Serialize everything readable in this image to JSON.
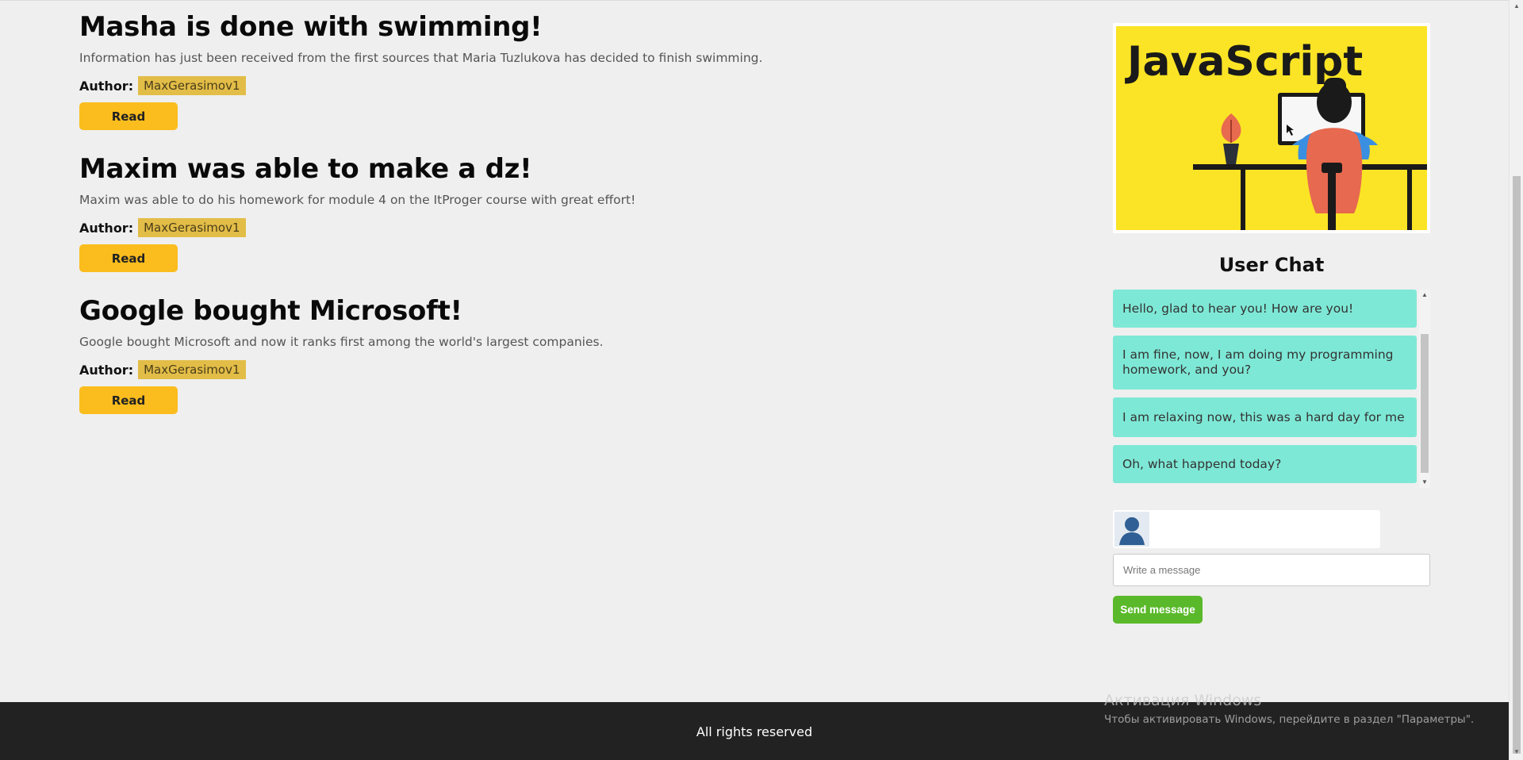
{
  "articles": [
    {
      "title": "Masha is done with swimming!",
      "description": "Information has just been received from the first sources that Maria Tuzlukova has decided to finish swimming.",
      "author_label": "Author:",
      "author": "MaxGerasimov1",
      "button": "Read"
    },
    {
      "title": "Maxim was able to make a dz!",
      "description": "Maxim was able to do his homework for module 4 on the ItProger course with great effort!",
      "author_label": "Author:",
      "author": "MaxGerasimov1",
      "button": "Read"
    },
    {
      "title": "Google bought Microsoft!",
      "description": "Google bought Microsoft and now it ranks first among the world's largest companies.",
      "author_label": "Author:",
      "author": "MaxGerasimov1",
      "button": "Read"
    }
  ],
  "sidebar": {
    "banner": {
      "text": "JavaScript",
      "background": "#fbe425"
    },
    "chat_title": "User Chat",
    "messages": [
      "Hello, glad to hear you! How are you!",
      "I am fine, now, I am doing my programming homework, and you?",
      "I am relaxing now, this was a hard day for me",
      "Oh, what happend today?"
    ],
    "avatar_icon": "user-silhouette-icon",
    "input_placeholder": "Write a message",
    "send_button": "Send message"
  },
  "footer": {
    "text": "All rights reserved"
  },
  "watermark": {
    "line1": "Активация Windows",
    "line2": "Чтобы активировать Windows, перейдите в раздел \"Параметры\"."
  },
  "colors": {
    "page_bg": "#efefef",
    "read_button": "#fbbd1e",
    "author_badge": "#e2bd47",
    "chat_bubble": "#7ee8d6",
    "send_button": "#5ab92a",
    "footer_bg": "#222222"
  }
}
